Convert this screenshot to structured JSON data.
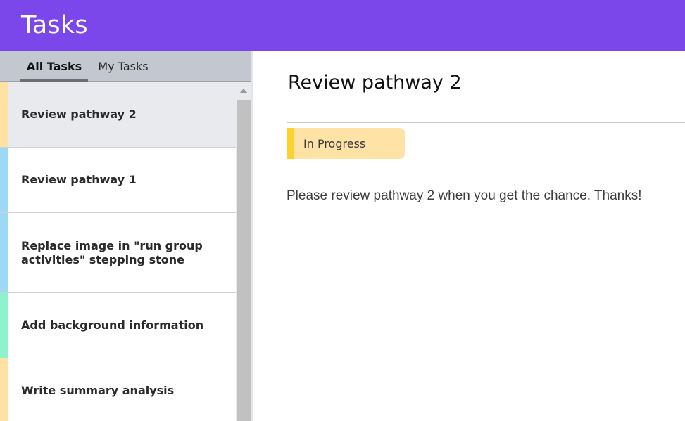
{
  "header": {
    "title": "Tasks"
  },
  "tabs": [
    {
      "label": "All Tasks",
      "active": true
    },
    {
      "label": "My Tasks",
      "active": false
    }
  ],
  "tasks": [
    {
      "title": "Review pathway 2",
      "color": "#ffe1a3",
      "selected": true
    },
    {
      "title": "Review pathway 1",
      "color": "#9dd8f4",
      "selected": false
    },
    {
      "title": "Replace image in \"run group activities\" stepping stone",
      "color": "#9dd8f4",
      "selected": false
    },
    {
      "title": "Add background information",
      "color": "#8ef3cd",
      "selected": false
    },
    {
      "title": "Write summary analysis",
      "color": "#ffe1a3",
      "selected": false
    }
  ],
  "detail": {
    "title": "Review pathway 2",
    "status": "In Progress",
    "status_color": "#fdd22e",
    "status_bg": "#ffe3a6",
    "description": "Please review pathway 2 when you get the chance. Thanks!"
  },
  "colors": {
    "header_bg": "#7b46ea",
    "tabs_bg": "#c3c7cf",
    "selected_row_bg": "#e9eaee"
  }
}
